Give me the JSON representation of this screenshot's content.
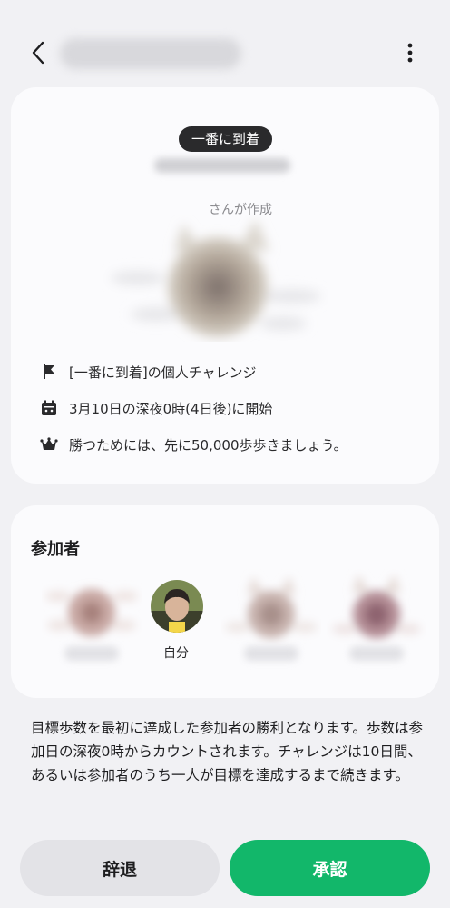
{
  "header": {
    "back_icon": "chevron-left-icon",
    "more_icon": "more-vertical-icon"
  },
  "challenge": {
    "badge": "一番に到着",
    "created_by_suffix": "さんが作成",
    "details": [
      {
        "icon": "flag-icon",
        "text": "[一番に到着]の個人チャレンジ"
      },
      {
        "icon": "calendar-icon",
        "text": "3月10日の深夜0時(4日後)に開始"
      },
      {
        "icon": "crown-icon",
        "text": "勝つためには、先に50,000歩歩きましょう。"
      }
    ]
  },
  "participants": {
    "title": "参加者",
    "self_label": "自分"
  },
  "notice": "目標歩数を最初に達成した参加者の勝利となります。歩数は参加日の深夜0時からカウントされます。チャレンジは10日間、あるいは参加者のうち一人が目標を達成するまで続きます。",
  "actions": {
    "decline": "辞退",
    "accept": "承認"
  },
  "colors": {
    "accent": "#12b76a",
    "background": "#f1f1f4",
    "card": "#fbfbfd"
  }
}
